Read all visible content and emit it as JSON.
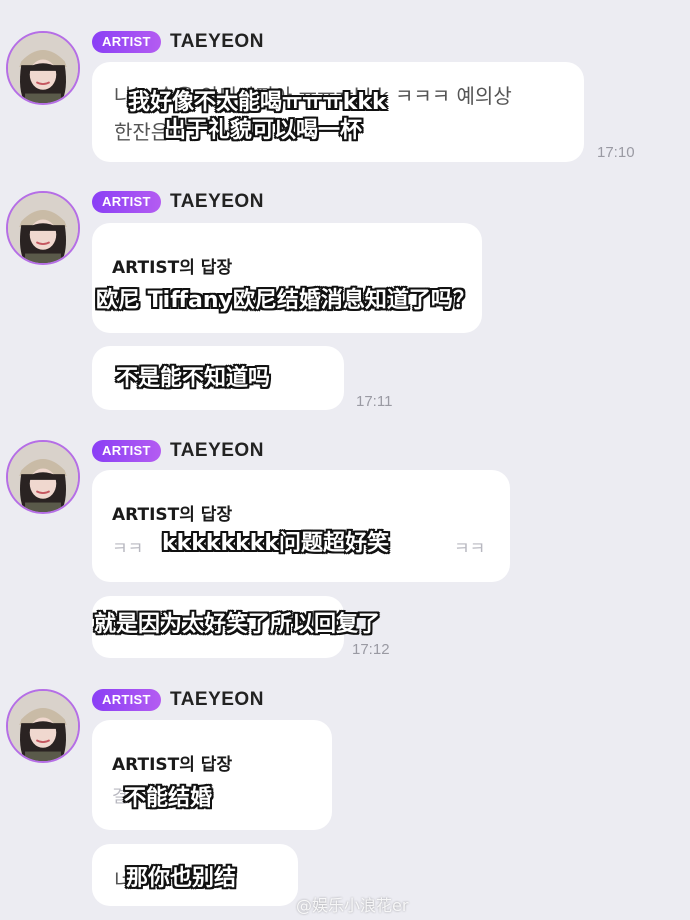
{
  "sender": {
    "badge": "ARTIST",
    "name": "TAEYEON"
  },
  "messages": [
    {
      "original_line1": "나는 술을 안되가지아 ㅠㅠㅠkkk ㅋㅋㅋ 예의상",
      "original_line2": "한잔은",
      "subtitle_line1": "我好像不太能喝ㅠㅠㅠkkk",
      "subtitle_line2": "出于礼貌可以喝一杯",
      "time": "17:10"
    },
    {
      "reply_title": "ARTIST의 답장",
      "reply_subtitle": "欧尼 Tiffany欧尼结婚消息知道了吗？",
      "answer_subtitle": "不是能不知道吗",
      "time": "17:11"
    },
    {
      "reply_title": "ARTIST의 답장",
      "reply_text_left": "ㅋㅋ",
      "reply_text_right": "ㅋㅋ",
      "reply_subtitle": "kkkkkkkk问题超好笑",
      "answer_subtitle": "就是因为太好笑了所以回复了",
      "time": "17:12"
    },
    {
      "reply_title": "ARTIST의 답장",
      "reply_text_left": "결",
      "reply_subtitle": "不能结婚",
      "answer_left": "너",
      "answer_subtitle": "那你也别结"
    }
  ],
  "watermark": "@娱乐小浪花er"
}
